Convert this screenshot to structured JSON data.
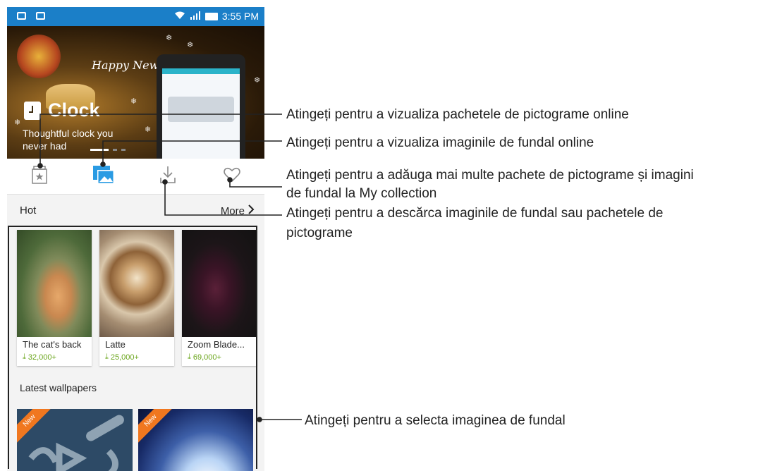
{
  "status_bar": {
    "time": "3:55 PM"
  },
  "banner": {
    "app_name": "Clock",
    "tagline": "Thoughtful clock you never had",
    "cursive_text": "Happy New Year"
  },
  "tabs": [
    {
      "icon": "theme-pack-icon",
      "selected": false
    },
    {
      "icon": "wallpaper-icon",
      "selected": true
    },
    {
      "icon": "download-icon",
      "selected": false
    },
    {
      "icon": "heart-icon",
      "selected": false
    }
  ],
  "hot_section": {
    "title": "Hot",
    "more_label": "More",
    "items": [
      {
        "name": "The cat's back",
        "downloads": "32,000+"
      },
      {
        "name": "Latte",
        "downloads": "25,000+"
      },
      {
        "name": "Zoom Blade...",
        "downloads": "69,000+"
      }
    ]
  },
  "latest_section": {
    "title": "Latest wallpapers",
    "items": [
      {
        "badge": "New"
      },
      {
        "badge": "New"
      }
    ]
  },
  "callouts": {
    "online_icon_packs": "Atingeți pentru a vizualiza pachetele de pictograme online",
    "online_wallpapers": "Atingeți pentru a vizualiza imaginile de fundal online",
    "my_collection_line1": "Atingeți pentru a adăuga mai multe pachete de pictograme și imagini",
    "my_collection_line2": "de fundal la My collection",
    "download_line1": "Atingeți pentru a descărca imaginile de fundal sau pachetele de",
    "download_line2": "pictograme",
    "select_wallpaper": "Atingeți pentru a selecta imaginea de fundal"
  },
  "colors": {
    "status_bar": "#1b7fc8",
    "accent": "#1b8fd8",
    "download_count": "#6aa51b",
    "new_badge": "#f0771f"
  }
}
